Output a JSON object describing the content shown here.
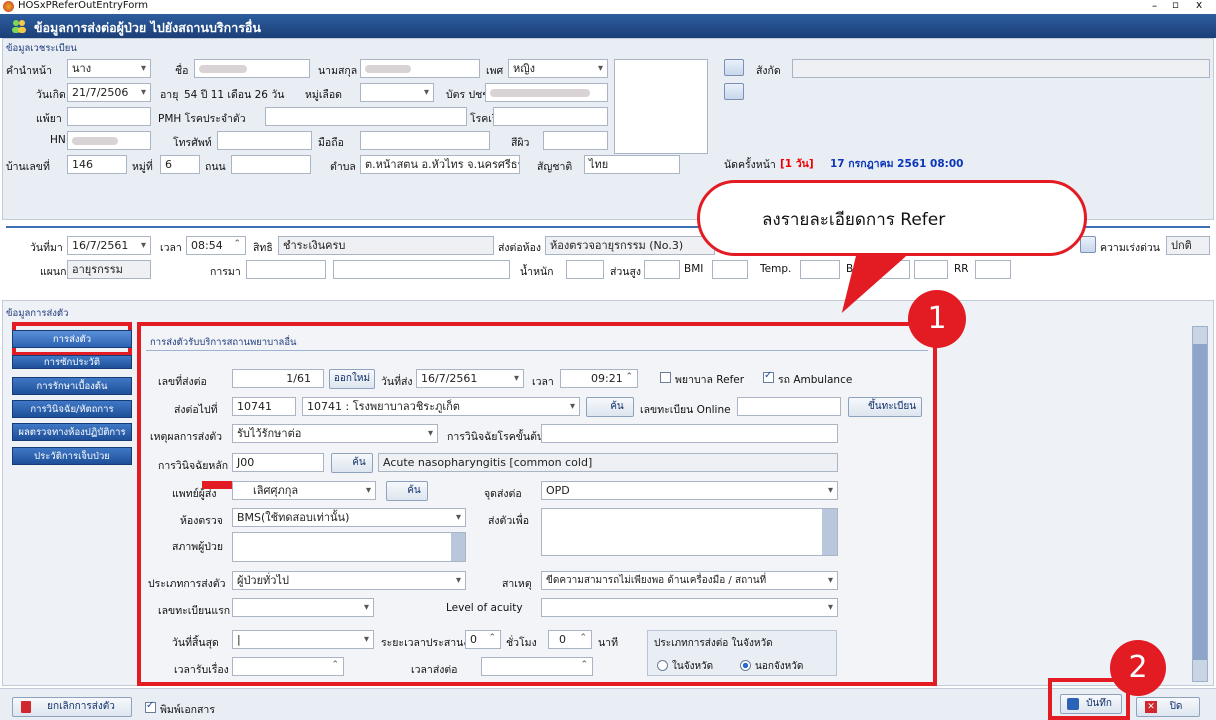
{
  "window": {
    "title": "HOSxPReferOutEntryForm",
    "controls": [
      "–",
      "▫",
      "x"
    ]
  },
  "header": {
    "title": "ข้อมูลการส่งต่อผู้ป่วย ไปยังสถานบริการอื่น"
  },
  "reg": {
    "section": "ข้อมูลเวชระเบียน",
    "title_label": "คำนำหน้า",
    "title_val": "นาง",
    "fname_label": "ชื่อ",
    "lname_label": "นามสกุล",
    "sex_label": "เพศ",
    "sex_val": "หญิง",
    "dob_label": "วันเกิด",
    "dob_val": "21/7/2506",
    "age_label": "อายุ",
    "age_val": "54 ปี 11 เดือน 26 วัน",
    "blood_label": "หมู่เลือด",
    "cid_label": "บัตร ปชช.",
    "allergy_label": "แพ้ยา",
    "pmh_label": "PMH โรคประจำตัว",
    "chronic_label": "โรคเรื้อรัง",
    "hn_label": "HN",
    "phone_label": "โทรศัพท์",
    "mobile_label": "มือถือ",
    "skin_label": "สีผิว",
    "house_label": "บ้านเลขที่",
    "house_val": "146",
    "moo_label": "หมู่ที่",
    "moo_val": "6",
    "road_label": "ถนน",
    "tambon_label": "ตำบล",
    "tambon_val": "ต.หน้าสตน อ.หัวไทร จ.นครศรีธรรมราช",
    "nation_label": "สัญชาติ",
    "nation_val": "ไทย",
    "affil_label": "สังกัด",
    "appoint_label": "นัดครั้งหน้า",
    "appoint_days": "[1 วัน]",
    "appoint_date": "17 กรกฎาคม 2561 08:00"
  },
  "visit": {
    "date_label": "วันที่มา",
    "date_val": "16/7/2561",
    "time_label": "เวลา",
    "time_val": "08:54",
    "right_label": "สิทธิ",
    "right_val": "ชำระเงินครบ",
    "send_room_label": "ส่งต่อห้อง",
    "send_room_val": "ห้องตรวจอายุรกรรม (No.3)",
    "dept_label": "แผนก",
    "dept_val": "อายุรกรรม",
    "come_label": "การมา",
    "weight_label": "น้ำหนัก",
    "height_label": "ส่วนสูง",
    "bmi_label": "BMI",
    "temp_label": "Temp.",
    "bp_label": "BP",
    "rr_label": "RR",
    "urgency_label": "ความเร่งด่วน",
    "urgency_val": "ปกติ"
  },
  "callout1": {
    "text": "ลงรายละเอียดการ Refer"
  },
  "badges": {
    "one": "1",
    "two": "2"
  },
  "refer": {
    "section": "ข้อมูลการส่งตัว",
    "nav": [
      "การส่งตัว",
      "การซักประวัติ",
      "การรักษาเบื้องต้น",
      "การวินิจฉัย/หัตถการ",
      "ผลตรวจทางห้องปฏิบัติการ",
      "ประวัติการเจ็บป่วย"
    ],
    "panel_title": "การส่งตัวรับบริการสถานพยาบาลอื่น",
    "no_label": "เลขที่ส่งต่อ",
    "no_val": "1/61",
    "new_btn": "ออกใหม่",
    "date_label": "วันที่ส่ง",
    "date_val": "16/7/2561",
    "time_label": "เวลา",
    "time_val": "09:21",
    "chk_nurse": "พยาบาล Refer",
    "chk_amb": "รถ Ambulance",
    "to_label": "ส่งต่อไปที่",
    "to_code": "10741",
    "to_val": "10741 : โรงพยาบาลวชิระภูเก็ต",
    "search": "ค้น",
    "online_label": "เลขทะเบียน Online",
    "register_btn": "ขึ้นทะเบียน",
    "reason_label": "เหตุผลการส่งตัว",
    "reason_val": "รับไว้รักษาต่อ",
    "prelim_label": "การวินิจฉัยโรคขั้นต้น",
    "main_dx_label": "การวินิจฉัยหลัก",
    "dx_code": "J00",
    "dx_name": "Acute nasopharyngitis [common cold]",
    "doctor_label": "แพทย์ผู้ส่ง",
    "doctor_val": "เลิศศุภกุล",
    "point_label": "จุดส่งต่อ",
    "point_val": "OPD",
    "room_label": "ห้องตรวจ",
    "room_val": "BMS(ใช้ทดสอบเท่านั้น)",
    "purpose_label": "ส่งตัวเพื่อ",
    "cond_label": "สภาพผู้ป่วย",
    "type_label": "ประเภทการส่งตัว",
    "type_val": "ผู้ป่วยทั่วไป",
    "cause_label": "สาเหตุ",
    "cause_val": "ขีดความสามารถไม่เพียงพอ ด้านเครื่องมือ / สถานที่",
    "first_label": "เลขทะเบียนแรก",
    "acuity_label": "Level of acuity",
    "end_label": "วันที่สิ้นสุด",
    "coord_label": "ระยะเวลาประสานงาน",
    "hour_val": "0",
    "hour_label": "ชั่วโมง",
    "min_val": "0",
    "min_label": "นาที",
    "recv_label": "เวลารับเรื่อง",
    "sendtime_label": "เวลาส่งต่อ",
    "prov_title": "ประเภทการส่งต่อ ในจังหวัด",
    "in_prov": "ในจังหวัด",
    "out_prov": "นอกจังหวัด"
  },
  "footer": {
    "cancel": "ยกเลิกการส่งตัว",
    "print": "พิมพ์เอกสาร",
    "save": "บันทึก",
    "close": "ปิด"
  }
}
